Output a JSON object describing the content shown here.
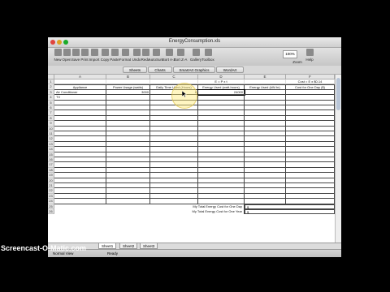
{
  "window": {
    "title": "EnergyConsumption.xls",
    "traffic_colors": [
      "#e0443e",
      "#dea123",
      "#1aab29"
    ]
  },
  "toolbar": {
    "items": [
      "New",
      "Open",
      "Save",
      "Print",
      "Import",
      "Copy",
      "Paste",
      "Format",
      "Undo",
      "Redo",
      "AutoSum",
      "Sort A-Z",
      "Sort Z-A",
      "Gallery",
      "Toolbox",
      "Zoom",
      "Help"
    ],
    "zoom_value": "100%"
  },
  "ribbon_tabs": [
    "Sheets",
    "Charts",
    "SmartArt Graphics",
    "WordArt"
  ],
  "columns": [
    "A",
    "B",
    "C",
    "D",
    "E",
    "F"
  ],
  "formula_row": {
    "D": "E = P x t",
    "F": "Cost = E x $0.14"
  },
  "headers": [
    "Appliance",
    "Power Usage (watts)",
    "Daily Time Used (Hours)",
    "Energy Used (watt-hours)",
    "Energy Used (kW-hr)",
    "Cost for One Day ($)"
  ],
  "rows": [
    {
      "num": "3",
      "cells": [
        "Air Conditioner",
        "3000",
        "8",
        "24000",
        "",
        ""
      ]
    },
    {
      "num": "4",
      "cells": [
        "TV",
        "",
        "",
        "",
        "",
        ""
      ]
    }
  ],
  "empty_row_numbers": [
    "5",
    "6",
    "7",
    "8",
    "9",
    "10",
    "11",
    "12",
    "13",
    "14",
    "15",
    "16",
    "17",
    "18",
    "19",
    "20",
    "21",
    "22",
    "23",
    "24"
  ],
  "top_row_numbers": [
    "1",
    "2"
  ],
  "footer_rows": [
    {
      "num": "25",
      "label": "My Total Energy Cost for One Day",
      "value": "$"
    },
    {
      "num": "26",
      "label": "My Total Energy Cost for One Year",
      "value": "$"
    }
  ],
  "sheet_tabs": [
    "Sheet1",
    "Sheet2",
    "Sheet3"
  ],
  "status": {
    "mode": "Normal View",
    "ready": "Ready"
  },
  "watermark": "Screencast-O-Matic.com"
}
